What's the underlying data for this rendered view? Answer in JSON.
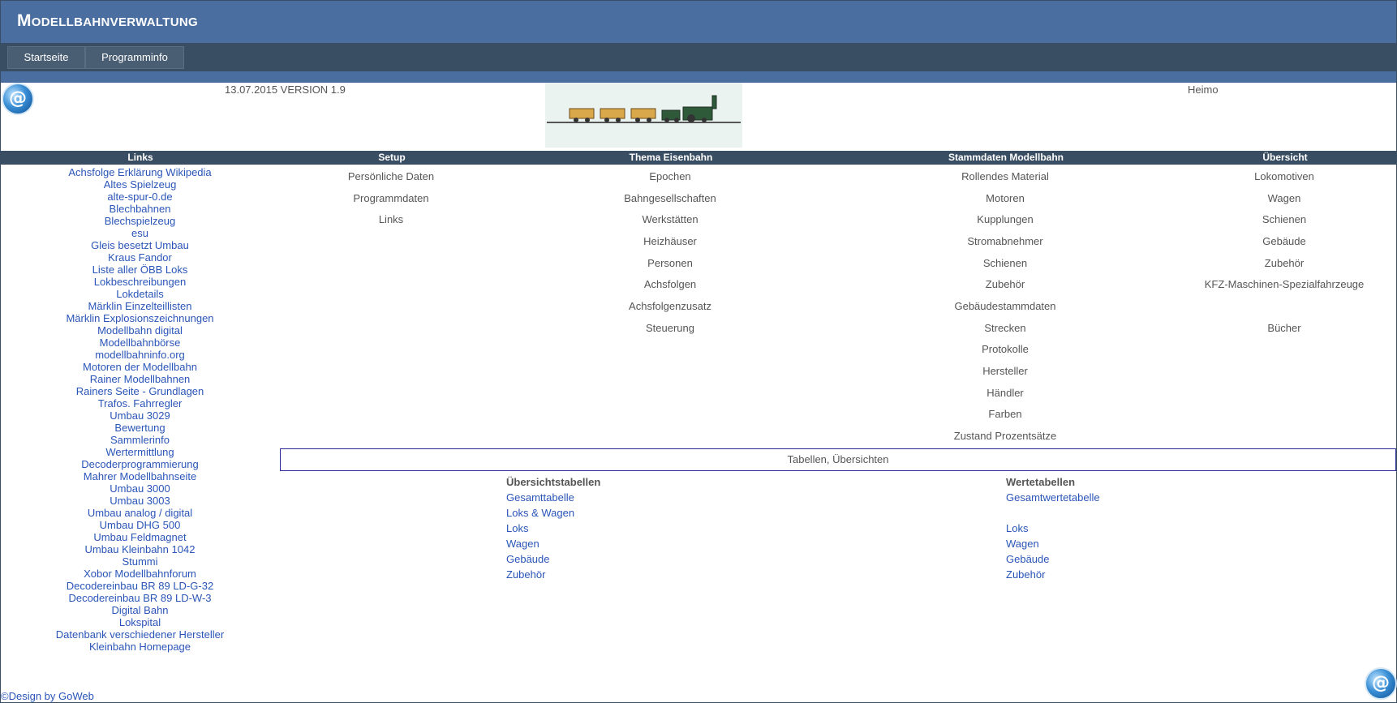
{
  "header": {
    "title": "Modellbahnverwaltung"
  },
  "nav": {
    "items": [
      "Startseite",
      "Programminfo"
    ]
  },
  "info": {
    "date_version": "13.07.2015  VERSION 1.9",
    "user": "Heimo"
  },
  "logo": {
    "icon": "at-sign-icon",
    "glyph": "@"
  },
  "categories": {
    "links": "Links",
    "setup": "Setup",
    "thema": "Thema Eisenbahn",
    "stammdaten": "Stammdaten Modellbahn",
    "uebersicht": "Übersicht"
  },
  "links": [
    "Achsfolge Erklärung Wikipedia",
    "Altes Spielzeug",
    "alte-spur-0.de",
    "Blechbahnen",
    "Blechspielzeug",
    "esu",
    "Gleis besetzt Umbau",
    "Kraus Fandor",
    "Liste aller ÖBB Loks",
    "Lokbeschreibungen",
    "Lokdetails",
    "Märklin Einzelteillisten",
    "Märklin Explosionszeichnungen",
    "Modellbahn digital",
    "Modellbahnbörse",
    "modellbahninfo.org",
    "Motoren der Modellbahn",
    "Rainer Modellbahnen",
    "Rainers Seite - Grundlagen",
    "Trafos. Fahrregler",
    "Umbau 3029",
    "Bewertung",
    "Sammlerinfo",
    "Wertermittlung",
    "Decoderprogrammierung",
    "Mahrer Modellbahnseite",
    "Umbau 3000",
    "Umbau 3003",
    "Umbau analog / digital",
    "Umbau DHG 500",
    "Umbau Feldmagnet",
    "Umbau Kleinbahn 1042",
    "Stummi",
    "Xobor Modellbahnforum",
    "Decodereinbau BR 89 LD-G-32",
    "Decodereinbau BR 89 LD-W-3",
    "Digital Bahn",
    "Lokspital",
    "Datenbank verschiedener Hersteller",
    "Kleinbahn Homepage"
  ],
  "setup": [
    "Persönliche Daten",
    "Programmdaten",
    "Links"
  ],
  "thema": [
    "Epochen",
    "Bahngesellschaften",
    "Werkstätten",
    "Heizhäuser",
    "Personen",
    "Achsfolgen",
    "Achsfolgenzusatz",
    "Steuerung"
  ],
  "stammdaten": [
    "Rollendes Material",
    "Motoren",
    "Kupplungen",
    "Stromabnehmer",
    "Schienen",
    "Zubehör",
    "Gebäudestammdaten",
    "Strecken",
    "Protokolle",
    "Hersteller",
    "Händler",
    "Farben",
    "Zustand Prozentsätze"
  ],
  "uebersicht": [
    "Lokomotiven",
    "Wagen",
    "Schienen",
    "Gebäude",
    "Zubehör",
    "KFZ-Maschinen-Spezialfahrzeuge",
    "",
    "Bücher"
  ],
  "tabellen": {
    "title": "Tabellen, Übersichten",
    "uebersicht_header": "Übersichtstabellen",
    "uebersicht_items": [
      "Gesamttabelle",
      "Loks & Wagen",
      "Loks",
      "Wagen",
      "Gebäude",
      "Zubehör"
    ],
    "werte_header": "Wertetabellen",
    "werte_items": [
      "Gesamtwertetabelle",
      "",
      "Loks",
      "Wagen",
      "Gebäude",
      "Zubehör"
    ]
  },
  "footer": {
    "text": "©Design by GoWeb"
  }
}
